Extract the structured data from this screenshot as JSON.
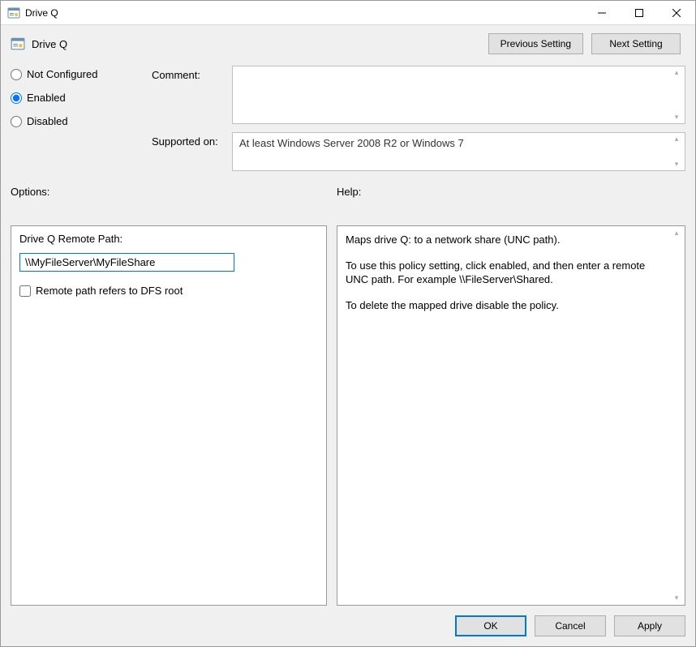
{
  "window": {
    "title": "Drive Q"
  },
  "header": {
    "policy_title": "Drive Q",
    "previous_setting": "Previous Setting",
    "next_setting": "Next Setting"
  },
  "radios": {
    "not_configured": "Not Configured",
    "enabled": "Enabled",
    "disabled": "Disabled",
    "selected": "enabled"
  },
  "labels": {
    "comment": "Comment:",
    "supported_on": "Supported on:",
    "options": "Options:",
    "help": "Help:"
  },
  "comment_value": "",
  "supported_on_value": "At least Windows Server 2008 R2 or Windows 7",
  "options": {
    "remote_path_label": "Drive Q Remote Path:",
    "remote_path_value": "\\\\MyFileServer\\MyFileShare",
    "dfs_checkbox_label": "Remote path refers to DFS root",
    "dfs_checked": false
  },
  "help_text": {
    "p1": "Maps drive Q: to a network share (UNC path).",
    "p2": "To use this policy setting, click enabled, and then enter a remote UNC path.  For example \\\\FileServer\\Shared.",
    "p3": "To delete the mapped drive disable the policy."
  },
  "footer": {
    "ok": "OK",
    "cancel": "Cancel",
    "apply": "Apply"
  }
}
